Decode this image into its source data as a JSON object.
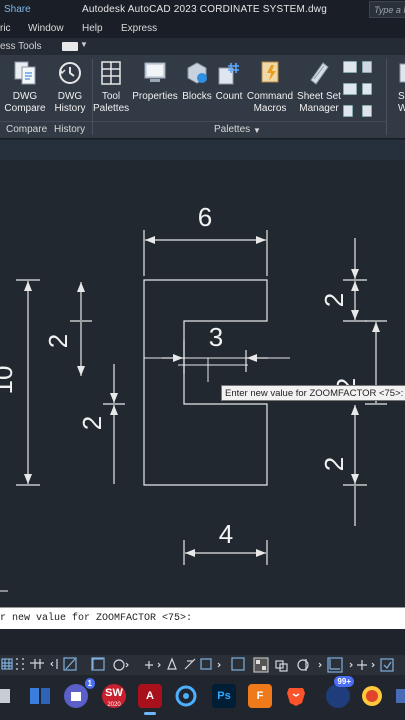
{
  "window": {
    "share": "Share",
    "title": "Autodesk AutoCAD 2023    CORDINATE SYSTEM.dwg",
    "help_search_placeholder": "Type a K"
  },
  "menu": {
    "items": [
      "ric",
      "Window",
      "Help",
      "Express"
    ]
  },
  "ribbon_tab": {
    "label": "ess Tools"
  },
  "ribbon": {
    "buttons": {
      "dwg_compare": "DWG Compare",
      "dwg_history": "DWG History",
      "tool_palettes": "Tool Palettes",
      "properties": "Properties",
      "blocks": "Blocks",
      "count": "Count",
      "command_macros": "Command Macros",
      "sheet_set_manager": "Sheet Set Manager",
      "cut_s": "S",
      "cut_w": "W"
    },
    "panels": {
      "compare": "Compare",
      "history": "History",
      "palettes": "Palettes"
    }
  },
  "drawing": {
    "dims": {
      "top_width": "6",
      "overall_height": "10",
      "left_upper": "2",
      "left_lower": "2",
      "inner_depth": "3",
      "right_top": "2",
      "right_mid": "2",
      "right_bottom": "2",
      "bottom_width": "4"
    },
    "tooltip": "Enter new value for ZOOMFACTOR <75>:"
  },
  "command_line": {
    "text": "r new value for ZOOMFACTOR <75>:"
  },
  "taskbar": {
    "sw_label": "SW",
    "sw_year": "2020",
    "cad_label": "A",
    "ps_label": "Ps",
    "f_label": "F",
    "badge_99": "99+",
    "badge_1": "1"
  },
  "colors": {
    "canvas": "#212830",
    "line": "#e8e8e8",
    "ribbon": "#323a46",
    "accent": "#7fb6e8"
  }
}
